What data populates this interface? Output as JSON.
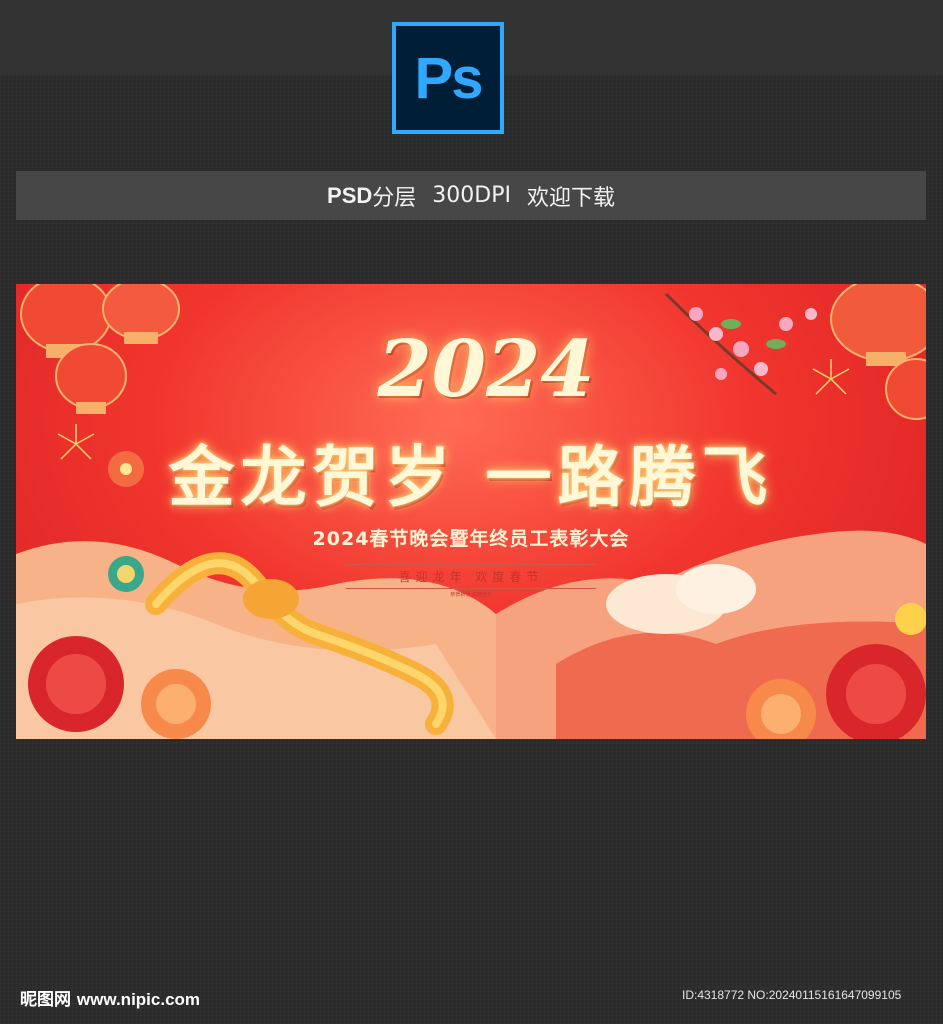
{
  "header": {
    "app_logo_text": "Ps",
    "info_bold": "PSD",
    "info_part1": "分层",
    "info_part2": "300DPI",
    "info_part3": "欢迎下载"
  },
  "banner": {
    "year_text": "2024",
    "title": "金龙贺岁 一路腾飞",
    "subtitle": "2024春节晚会暨年终员工表彰大会",
    "slogan": "喜迎龙年 欢度春节",
    "fine_print": "恭贺新禧 欢度佳节"
  },
  "footer": {
    "watermark_brand": "昵图网",
    "watermark_url": "www.nipic.com",
    "id_text": "ID:4318772 NO:20240115161647099105"
  },
  "colors": {
    "ps_blue": "#31a8ff",
    "ps_dark": "#001e36",
    "banner_red": "#f1352e",
    "gold": "#fff7d6"
  }
}
